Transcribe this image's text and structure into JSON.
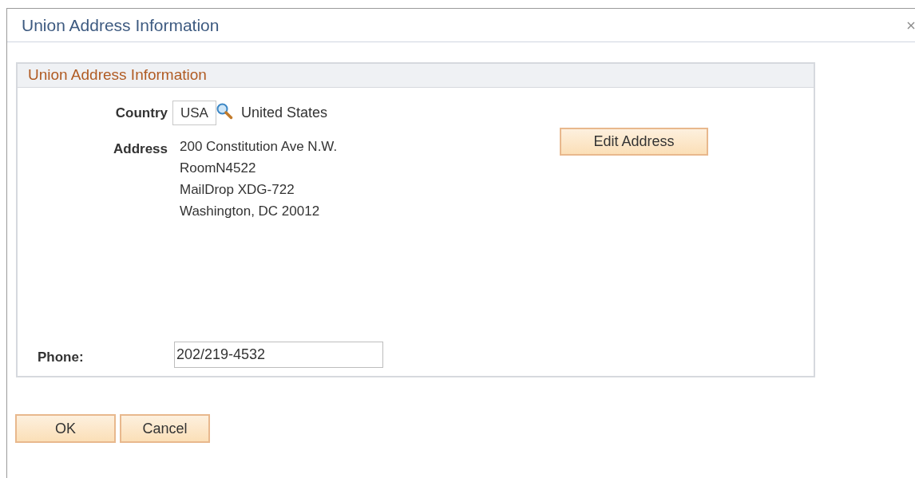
{
  "window": {
    "title": "Union Address Information"
  },
  "group": {
    "title": "Union Address Information",
    "country": {
      "label": "Country",
      "code": "USA",
      "name": "United States"
    },
    "address": {
      "label": "Address",
      "lines": [
        "200 Constitution Ave N.W.",
        "RoomN4522",
        "MailDrop XDG-722",
        "Washington, DC 20012"
      ]
    },
    "edit_button": "Edit Address",
    "phone": {
      "label": "Phone:",
      "value": "202/219-4532"
    }
  },
  "buttons": [
    "OK",
    "Cancel"
  ]
}
